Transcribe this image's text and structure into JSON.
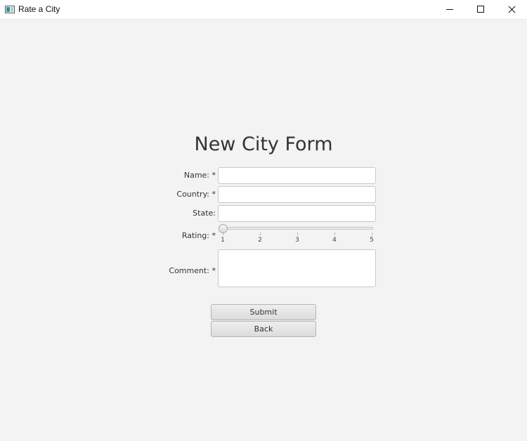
{
  "window": {
    "title": "Rate a City",
    "icon": "app-window-icon",
    "controls": [
      "minimize-icon",
      "maximize-icon",
      "close-icon"
    ]
  },
  "form": {
    "title": "New City Form",
    "fields": {
      "name": {
        "label": "Name: *",
        "value": ""
      },
      "country": {
        "label": "Country: *",
        "value": ""
      },
      "state": {
        "label": "State:",
        "value": ""
      },
      "rating": {
        "label": "Rating: *",
        "min": 1,
        "max": 5,
        "value": 1,
        "ticks": [
          "1",
          "2",
          "3",
          "4",
          "5"
        ]
      },
      "comment": {
        "label": "Comment: *",
        "value": ""
      }
    },
    "buttons": {
      "submit": "Submit",
      "back": "Back"
    }
  },
  "colors": {
    "background": "#f3f3f3",
    "titlebar": "#ffffff",
    "field_border": "#c8c8c8",
    "button_face": "#e4e4e4"
  }
}
